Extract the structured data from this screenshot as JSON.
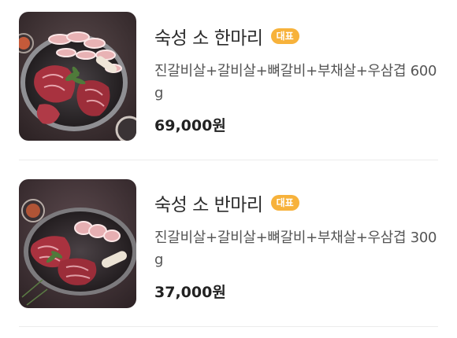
{
  "items": [
    {
      "name": "숙성 소 한마리",
      "badge": "대표",
      "description": "진갈비살+갈비살+뼈갈비+부채살+우삼겹 600g",
      "price": "69,000원",
      "image_icon": "grilled-beef-platter-photo"
    },
    {
      "name": "숙성 소 반마리",
      "badge": "대표",
      "description": "진갈비살+갈비살+뼈갈비+부채살+우삼겹 300g",
      "price": "37,000원",
      "image_icon": "grilled-beef-platter-photo"
    }
  ],
  "colors": {
    "badge": "#f7b23b",
    "divider": "#ececec",
    "text_primary": "#222222",
    "text_secondary": "#555555"
  }
}
